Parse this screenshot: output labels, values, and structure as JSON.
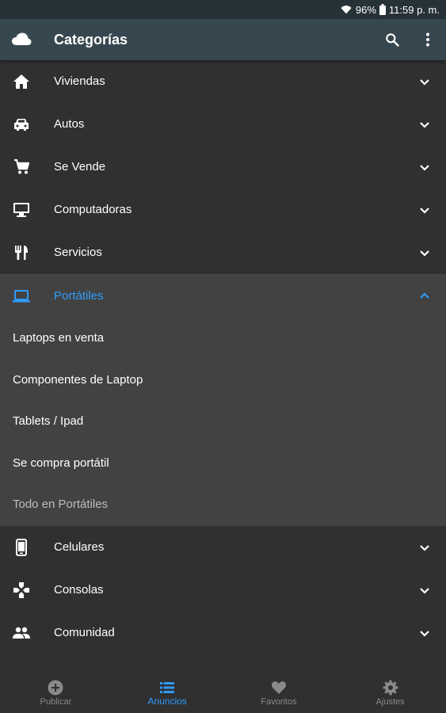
{
  "status_bar": {
    "battery": "96%",
    "time": "11:59 p. m."
  },
  "app_bar": {
    "title": "Categorías",
    "logo_icon": "cloud-icon",
    "actions": [
      "search-icon",
      "more-vert-icon"
    ]
  },
  "categories_top": [
    {
      "label": "Viviendas",
      "icon": "home-icon"
    },
    {
      "label": "Autos",
      "icon": "car-icon"
    },
    {
      "label": "Se Vende",
      "icon": "cart-icon"
    },
    {
      "label": "Computadoras",
      "icon": "desktop-icon"
    },
    {
      "label": "Servicios",
      "icon": "restaurant-icon"
    }
  ],
  "expanded_category": {
    "label": "Portátiles",
    "icon": "laptop-icon",
    "subitems": [
      "Laptops en venta",
      "Componentes de Laptop",
      "Tablets / Ipad",
      "Se compra portátil",
      "Todo en Portátiles"
    ]
  },
  "categories_bottom": [
    {
      "label": "Celulares",
      "icon": "phone-icon"
    },
    {
      "label": "Consolas",
      "icon": "gamepad-icon"
    },
    {
      "label": "Comunidad",
      "icon": "people-icon"
    }
  ],
  "bottom_nav": [
    {
      "label": "Publicar",
      "icon": "add-circle-icon",
      "active": false
    },
    {
      "label": "Anuncios",
      "icon": "list-icon",
      "active": true
    },
    {
      "label": "Favoritos",
      "icon": "heart-icon",
      "active": false
    },
    {
      "label": "Ajustes",
      "icon": "gear-icon",
      "active": false
    }
  ],
  "colors": {
    "app_bar": "#37474f",
    "background": "#303030",
    "expanded_bg": "#424242",
    "accent": "#2f9bff"
  }
}
